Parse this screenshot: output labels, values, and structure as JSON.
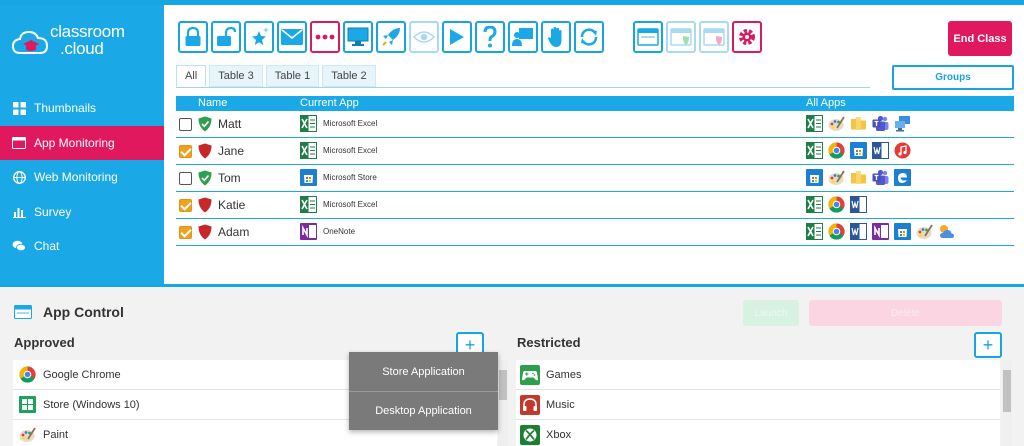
{
  "app": {
    "logo_line1": "classroom",
    "logo_line2": ".cloud",
    "accent": "#1aa9e6",
    "highlight": "#e0195f"
  },
  "sidebar": {
    "items": [
      {
        "label": "Thumbnails",
        "icon": "grid-icon",
        "active": false
      },
      {
        "label": "App Monitoring",
        "icon": "window-icon",
        "active": true
      },
      {
        "label": "Web Monitoring",
        "icon": "globe-icon",
        "active": false
      },
      {
        "label": "Survey",
        "icon": "bar-chart-icon",
        "active": false
      },
      {
        "label": "Chat",
        "icon": "chat-icon",
        "active": false
      }
    ]
  },
  "toolbar": {
    "buttons": [
      "lock-icon",
      "unlock-icon",
      "star-sparkle-icon",
      "message-icon",
      "dots-icon",
      "monitor-icon",
      "rocket-icon",
      "eye-icon",
      "play-icon",
      "help-icon",
      "presenter-icon",
      "hand-icon",
      "refresh-icon",
      "window-icon",
      "allowed-window-icon",
      "blocked-window-icon",
      "settings-icon"
    ],
    "end_class": "End Class"
  },
  "tabs": [
    "All",
    "Table 3",
    "Table 1",
    "Table 2"
  ],
  "groups_label": "Groups",
  "table": {
    "headers": {
      "name": "Name",
      "current_app": "Current App",
      "all_apps": "All Apps"
    },
    "rows": [
      {
        "name": "Matt",
        "checked": false,
        "status": "safe",
        "current_app": "Microsoft Excel",
        "current_icon": "excel",
        "apps": [
          "excel",
          "paint",
          "folder",
          "teams",
          "remote"
        ]
      },
      {
        "name": "Jane",
        "checked": true,
        "status": "alert",
        "current_app": "Microsoft Excel",
        "current_icon": "excel",
        "apps": [
          "excel",
          "chrome",
          "store",
          "word",
          "music"
        ]
      },
      {
        "name": "Tom",
        "checked": false,
        "status": "safe",
        "current_app": "Microsoft Store",
        "current_icon": "store",
        "apps": [
          "store",
          "paint",
          "folder",
          "teams",
          "edge"
        ]
      },
      {
        "name": "Katie",
        "checked": true,
        "status": "alert",
        "current_app": "Microsoft Excel",
        "current_icon": "excel",
        "apps": [
          "excel",
          "chrome",
          "word"
        ]
      },
      {
        "name": "Adam",
        "checked": true,
        "status": "alert",
        "current_app": "OneNote",
        "current_icon": "onenote",
        "apps": [
          "excel",
          "chrome",
          "word",
          "onenote",
          "store",
          "paint",
          "weather"
        ]
      }
    ]
  },
  "app_control": {
    "title": "App Control",
    "launch": "Launch",
    "delete": "Delete",
    "approved_title": "Approved",
    "restricted_title": "Restricted",
    "approved": [
      {
        "label": "Google Chrome",
        "icon": "chrome"
      },
      {
        "label": "Store (Windows 10)",
        "icon": "store-green"
      },
      {
        "label": "Paint",
        "icon": "paint"
      }
    ],
    "restricted": [
      {
        "label": "Games",
        "icon": "gamepad"
      },
      {
        "label": "Music",
        "icon": "headphones"
      },
      {
        "label": "Xbox",
        "icon": "xbox"
      }
    ]
  },
  "popup": [
    "Store Application",
    "Desktop Application"
  ]
}
